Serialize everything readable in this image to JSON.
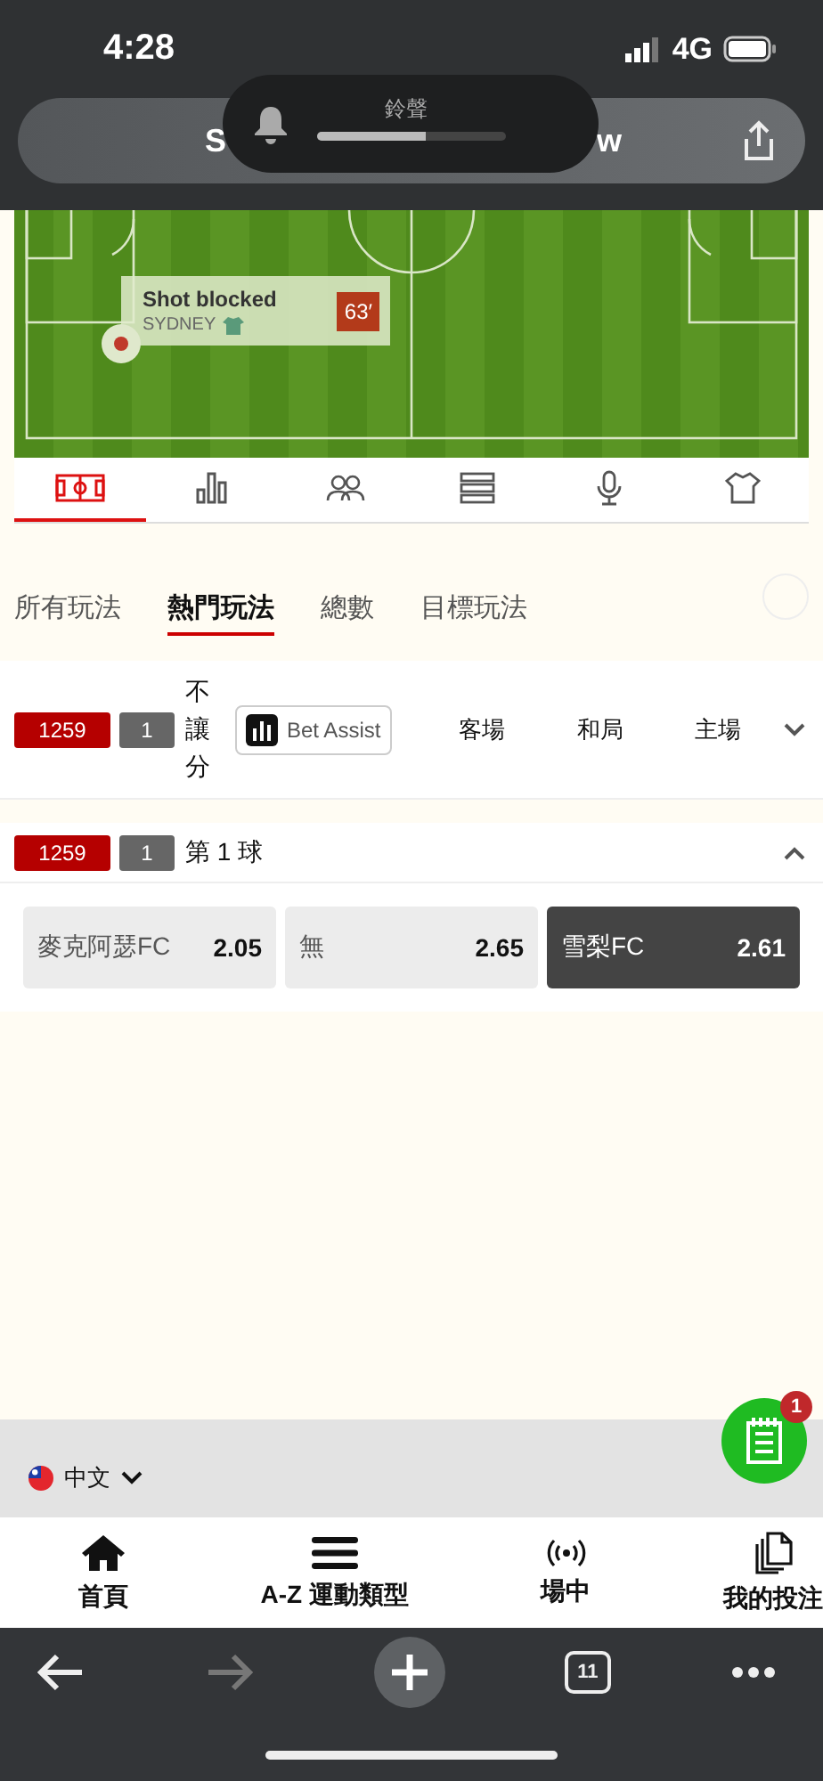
{
  "status_bar": {
    "time": "4:28",
    "network": "4G"
  },
  "address_bar": {
    "title_start": "S",
    "title_end": "w"
  },
  "volume_popup": {
    "label": "鈴聲",
    "level": 0.58
  },
  "pitch": {
    "event": "Shot blocked",
    "team": "SYDNEY",
    "minute": "63′"
  },
  "stat_tabs": [
    {
      "kind": "pitch",
      "selected": true
    },
    {
      "kind": "stats",
      "selected": false
    },
    {
      "kind": "lineups",
      "selected": false
    },
    {
      "kind": "table",
      "selected": false
    },
    {
      "kind": "commentary",
      "selected": false
    },
    {
      "kind": "shirt",
      "selected": false
    }
  ],
  "market_tabs": [
    {
      "label": "所有玩法",
      "selected": false
    },
    {
      "label": "熱門玩法",
      "selected": true
    },
    {
      "label": "總數",
      "selected": false
    },
    {
      "label": "目標玩法",
      "selected": false
    }
  ],
  "markets": [
    {
      "code": "1259",
      "number": "1",
      "name": "不讓分",
      "vertical": true,
      "expanded": false,
      "assist": "Bet Assist",
      "columns": [
        "客場",
        "和局",
        "主場"
      ]
    },
    {
      "code": "1259",
      "number": "1",
      "name": "第 1 球",
      "vertical": false,
      "expanded": true,
      "odds": [
        {
          "label": "麥克阿瑟FC",
          "price": "2.05",
          "selected": false
        },
        {
          "label": "無",
          "price": "2.65",
          "selected": false
        },
        {
          "label": "雪梨FC",
          "price": "2.61",
          "selected": true
        }
      ]
    }
  ],
  "language": "中文",
  "betslip_count": "1",
  "bottom_nav": [
    {
      "kind": "home",
      "label": "首頁"
    },
    {
      "kind": "menu",
      "label": "A-Z 運動類型"
    },
    {
      "kind": "live",
      "label": "場中"
    },
    {
      "kind": "bets",
      "label": "我的投注"
    }
  ],
  "browser_bar": {
    "tab_count": "11",
    "forward_disabled": true
  }
}
